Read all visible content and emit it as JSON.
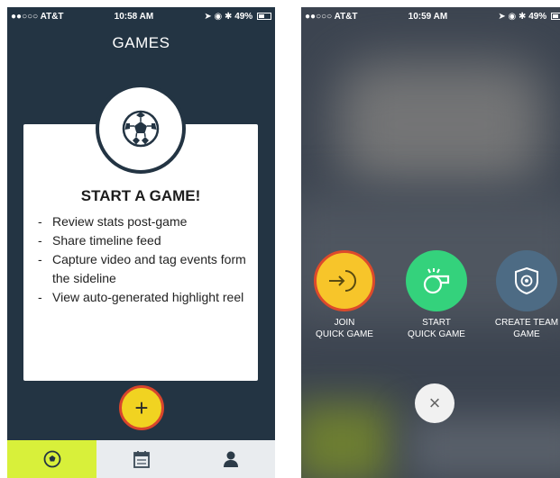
{
  "left_screen": {
    "status": {
      "carrier": "●●○○○ AT&T",
      "time": "10:58 AM",
      "battery": "49%"
    },
    "title": "GAMES",
    "card": {
      "heading": "START A GAME!",
      "items": [
        "Review stats post-game",
        "Share timeline feed",
        "Capture video and tag events form the sideline",
        "View auto-generated highlight reel"
      ]
    },
    "fab_label": "+",
    "tabs": [
      {
        "icon": "soccer-ball-icon",
        "active": true
      },
      {
        "icon": "calendar-icon",
        "active": false
      },
      {
        "icon": "person-icon",
        "active": false
      }
    ]
  },
  "right_screen": {
    "status": {
      "carrier": "●●○○○ AT&T",
      "time": "10:59 AM",
      "battery": "49%"
    },
    "actions": [
      {
        "label": "JOIN\nQUICK GAME",
        "icon": "join-arrow-icon",
        "color": "#f7c52a"
      },
      {
        "label": "START\nQUICK GAME",
        "icon": "whistle-icon",
        "color": "#34d27c"
      },
      {
        "label": "CREATE TEAM\nGAME",
        "icon": "team-shield-icon",
        "color": "#4d6b84"
      }
    ],
    "close_label": "×"
  },
  "colors": {
    "navy": "#233443",
    "accent_yellow": "#f1d321",
    "accent_red": "#d8452c",
    "tab_active": "#d8f03a",
    "green": "#34d27c",
    "slate": "#4d6b84"
  }
}
